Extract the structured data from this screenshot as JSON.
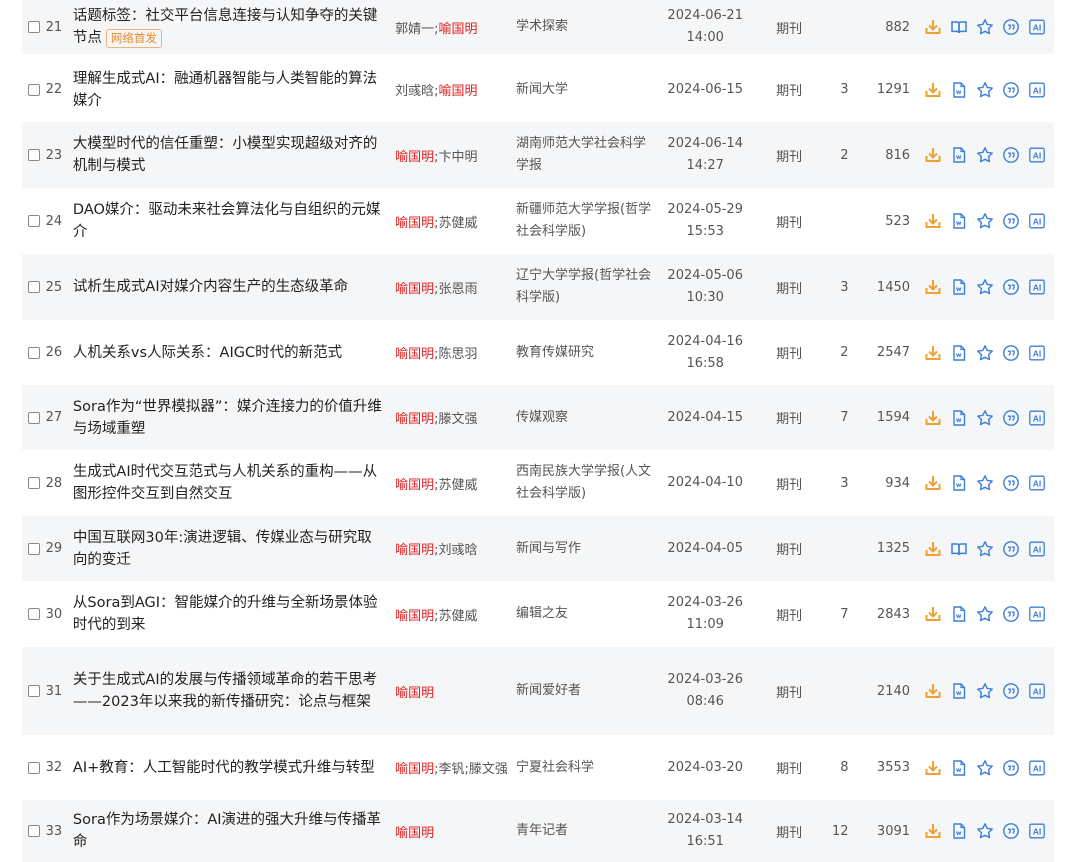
{
  "badge_label": "网络首发",
  "rows": [
    {
      "num": "21",
      "title": "话题标签：社交平台信息连接与认知争夺的关键节点",
      "badge": true,
      "authors": [
        {
          "name": "郭婧一",
          "hl": false
        },
        {
          "name": "喻国明",
          "hl": true
        }
      ],
      "source": "学术探索",
      "date": "2024-06-21",
      "time": "14:00",
      "type": "期刊",
      "cite": "",
      "downloads": "882",
      "read_icon": "book-icon"
    },
    {
      "num": "22",
      "title": "理解生成式AI：融通机器智能与人类智能的算法媒介",
      "badge": false,
      "authors": [
        {
          "name": "刘彧晗",
          "hl": false
        },
        {
          "name": "喻国明",
          "hl": true
        }
      ],
      "source": "新闻大学",
      "date": "2024-06-15",
      "time": "",
      "type": "期刊",
      "cite": "3",
      "downloads": "1291",
      "read_icon": "html-doc-icon"
    },
    {
      "num": "23",
      "title": "大模型时代的信任重塑：小模型实现超级对齐的机制与模式",
      "badge": false,
      "authors": [
        {
          "name": "喻国明",
          "hl": true
        },
        {
          "name": "卞中明",
          "hl": false
        }
      ],
      "source": "湖南师范大学社会科学学报",
      "date": "2024-06-14",
      "time": "14:27",
      "type": "期刊",
      "cite": "2",
      "downloads": "816",
      "read_icon": "html-doc-icon"
    },
    {
      "num": "24",
      "title": "DAO媒介：驱动未来社会算法化与自组织的元媒介",
      "badge": false,
      "authors": [
        {
          "name": "喻国明",
          "hl": true
        },
        {
          "name": "苏健威",
          "hl": false
        }
      ],
      "source": "新疆师范大学学报(哲学社会科学版)",
      "date": "2024-05-29",
      "time": "15:53",
      "type": "期刊",
      "cite": "",
      "downloads": "523",
      "read_icon": "html-doc-icon"
    },
    {
      "num": "25",
      "title": "试析生成式AI对媒介内容生产的生态级革命",
      "badge": false,
      "authors": [
        {
          "name": "喻国明",
          "hl": true
        },
        {
          "name": "张恩雨",
          "hl": false
        }
      ],
      "source": "辽宁大学学报(哲学社会科学版)",
      "date": "2024-05-06",
      "time": "10:30",
      "type": "期刊",
      "cite": "3",
      "downloads": "1450",
      "read_icon": "html-doc-icon"
    },
    {
      "num": "26",
      "title": "人机关系vs人际关系：AIGC时代的新范式",
      "badge": false,
      "authors": [
        {
          "name": "喻国明",
          "hl": true
        },
        {
          "name": "陈思羽",
          "hl": false
        }
      ],
      "source": "教育传媒研究",
      "date": "2024-04-16",
      "time": "16:58",
      "type": "期刊",
      "cite": "2",
      "downloads": "2547",
      "read_icon": "html-doc-icon"
    },
    {
      "num": "27",
      "title": "Sora作为“世界模拟器”：媒介连接力的价值升维与场域重塑",
      "badge": false,
      "authors": [
        {
          "name": "喻国明",
          "hl": true
        },
        {
          "name": "滕文强",
          "hl": false
        }
      ],
      "source": "传媒观察",
      "date": "2024-04-15",
      "time": "",
      "type": "期刊",
      "cite": "7",
      "downloads": "1594",
      "read_icon": "html-doc-icon"
    },
    {
      "num": "28",
      "title": "生成式AI时代交互范式与人机关系的重构——从图形控件交互到自然交互",
      "badge": false,
      "authors": [
        {
          "name": "喻国明",
          "hl": true
        },
        {
          "name": "苏健威",
          "hl": false
        }
      ],
      "source": "西南民族大学学报(人文社会科学版)",
      "date": "2024-04-10",
      "time": "",
      "type": "期刊",
      "cite": "3",
      "downloads": "934",
      "read_icon": "html-doc-icon"
    },
    {
      "num": "29",
      "title": "中国互联网30年:演进逻辑、传媒业态与研究取向的变迁",
      "badge": false,
      "authors": [
        {
          "name": "喻国明",
          "hl": true
        },
        {
          "name": "刘彧晗",
          "hl": false
        }
      ],
      "source": "新闻与写作",
      "date": "2024-04-05",
      "time": "",
      "type": "期刊",
      "cite": "",
      "downloads": "1325",
      "read_icon": "book-icon"
    },
    {
      "num": "30",
      "title": "从Sora到AGI：智能媒介的升维与全新场景体验时代的到来",
      "badge": false,
      "authors": [
        {
          "name": "喻国明",
          "hl": true
        },
        {
          "name": "苏健威",
          "hl": false
        }
      ],
      "source": "编辑之友",
      "date": "2024-03-26",
      "time": "11:09",
      "type": "期刊",
      "cite": "7",
      "downloads": "2843",
      "read_icon": "html-doc-icon"
    },
    {
      "num": "31",
      "title": "关于生成式AI的发展与传播领域革命的若干思考——2023年以来我的新传播研究：论点与框架",
      "badge": false,
      "authors": [
        {
          "name": "喻国明",
          "hl": true
        }
      ],
      "source": "新闻爱好者",
      "date": "2024-03-26",
      "time": "08:46",
      "type": "期刊",
      "cite": "",
      "downloads": "2140",
      "read_icon": "html-doc-icon"
    },
    {
      "num": "32",
      "title": "AI+教育：人工智能时代的教学模式升维与转型",
      "badge": false,
      "authors": [
        {
          "name": "喻国明",
          "hl": true
        },
        {
          "name": "李钒",
          "hl": false
        },
        {
          "name": "滕文强",
          "hl": false
        }
      ],
      "source": "宁夏社会科学",
      "date": "2024-03-20",
      "time": "",
      "type": "期刊",
      "cite": "8",
      "downloads": "3553",
      "read_icon": "html-doc-icon"
    },
    {
      "num": "33",
      "title": "Sora作为场景媒介：AI演进的强大升维与传播革命",
      "badge": false,
      "authors": [
        {
          "name": "喻国明",
          "hl": true
        }
      ],
      "source": "青年记者",
      "date": "2024-03-14",
      "time": "16:51",
      "type": "期刊",
      "cite": "12",
      "downloads": "3091",
      "read_icon": "html-doc-icon"
    }
  ],
  "colors": {
    "highlight": "#e02020",
    "download": "#f0a030",
    "icon_blue": "#3d7fd8"
  }
}
